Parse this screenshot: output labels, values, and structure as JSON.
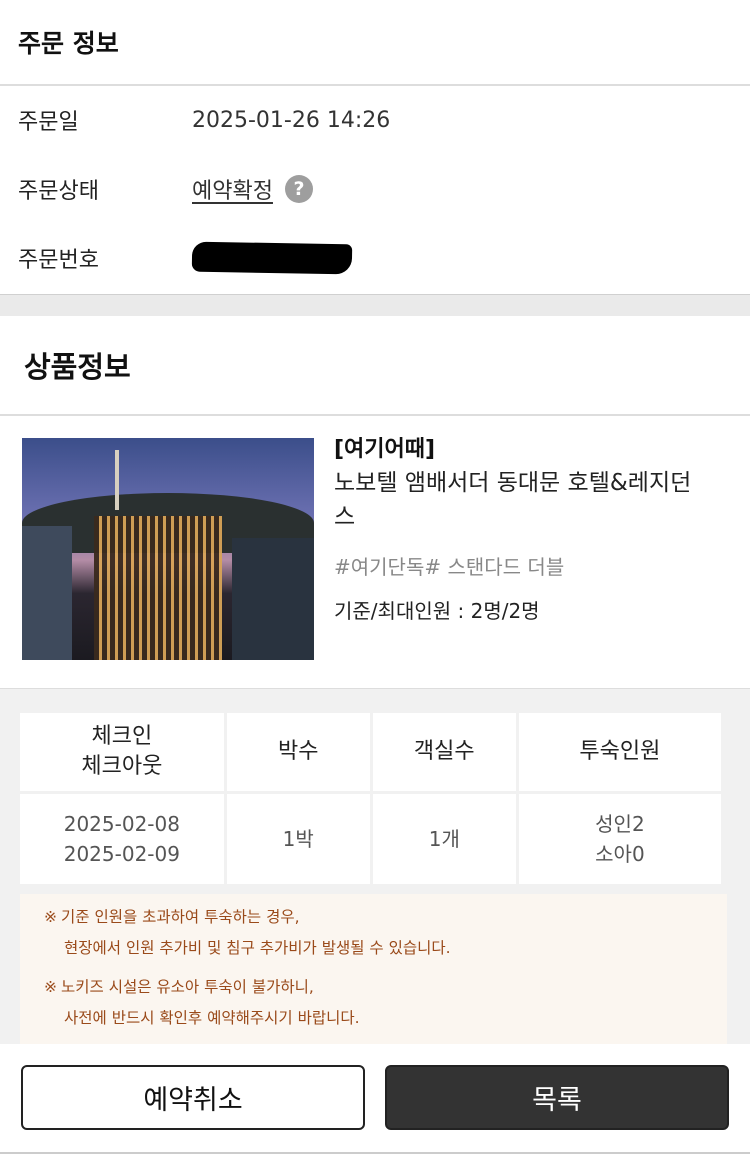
{
  "order": {
    "title": "주문 정보",
    "date_label": "주문일",
    "date_value": "2025-01-26 14:26",
    "status_label": "주문상태",
    "status_value": "예약확정",
    "help_icon": "?",
    "number_label": "주문번호"
  },
  "product": {
    "title": "상품정보",
    "brand": "[여기어때]",
    "name_line1": "노보텔 앰배서더 동대문 호텔&레지던",
    "name_line2": "스",
    "room": "#여기단독# 스탠다드 더블",
    "capacity": "기준/최대인원 : 2명/2명"
  },
  "stay": {
    "headers": {
      "checkin": "체크인",
      "checkout": "체크아웃",
      "nights": "박수",
      "rooms": "객실수",
      "guests": "투숙인원"
    },
    "values": {
      "checkin": "2025-02-08",
      "checkout": "2025-02-09",
      "nights": "1박",
      "rooms": "1개",
      "adults": "성인2",
      "children": "소아0"
    }
  },
  "notice": {
    "mark": "※",
    "item1_line1": "기준 인원을 초과하여 투숙하는 경우,",
    "item1_line2": "현장에서 인원 추가비 및 침구 추가비가 발생될 수 있습니다.",
    "item2_line1": "노키즈 시설은 유소아 투숙이 불가하니,",
    "item2_line2": "사전에 반드시 확인후 예약해주시기 바랍니다."
  },
  "buttons": {
    "cancel": "예약취소",
    "list": "목록"
  }
}
